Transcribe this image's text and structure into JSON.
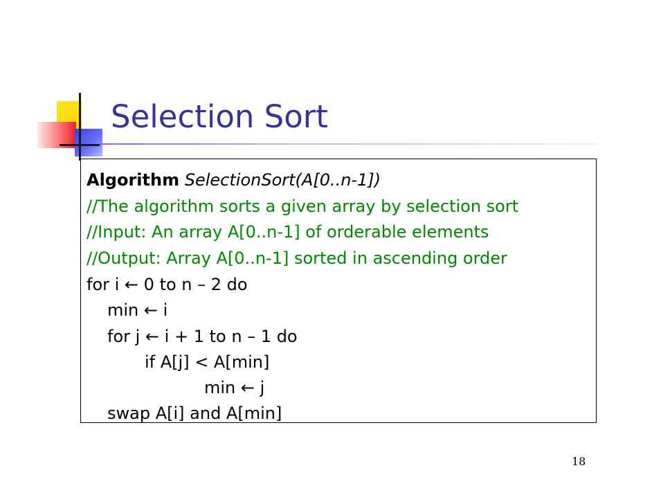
{
  "slide": {
    "title": "Selection Sort",
    "page_number": "18"
  },
  "algorithm": {
    "keyword": "Algorithm",
    "signature": "SelectionSort(A[0..n-1])",
    "comments": [
      "//The algorithm sorts a given array by selection sort",
      "//Input: An array A[0..n-1] of orderable elements",
      "//Output: Array A[0..n-1] sorted in ascending order"
    ],
    "code": [
      "for i ← 0 to n – 2 do",
      "min ← i",
      "for j ← i + 1 to n – 1 do",
      "if A[j] < A[min]",
      "min ← j",
      "swap A[i] and A[min]"
    ]
  },
  "colors": {
    "title": "#333399",
    "comment": "#008800",
    "text": "#000000"
  },
  "icons": [
    "logo-squares-icon"
  ]
}
